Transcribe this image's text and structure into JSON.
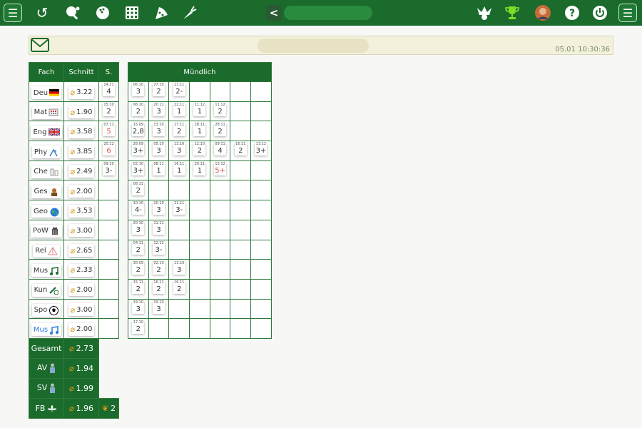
{
  "topbar": {
    "left_icons": [
      "menu-icon",
      "history-icon",
      "table-tennis-icon",
      "bowling-icon",
      "calculator-icon",
      "pizza-icon",
      "carrot-icon"
    ],
    "right_icons": [
      "jester-icon",
      "trophy-icon",
      "avatar",
      "help-icon",
      "power-icon",
      "menu-icon"
    ],
    "back_label": "<"
  },
  "message_bar": {
    "timestamp": "05.01 10:30:36"
  },
  "left_table": {
    "headers": {
      "subject": "Fach",
      "average": "Schnitt",
      "written": "S."
    },
    "rows": [
      {
        "subject": "Deu",
        "avg": "3.22",
        "written": {
          "date": "14.11",
          "grade": "4",
          "red": false
        }
      },
      {
        "subject": "Mat",
        "avg": "1.90",
        "written": {
          "date": "15.10",
          "grade": "2",
          "red": false
        }
      },
      {
        "subject": "Eng",
        "avg": "3.58",
        "written": {
          "date": "07.11",
          "grade": "5",
          "red": true
        }
      },
      {
        "subject": "Phy",
        "avg": "3.85",
        "written": {
          "date": "20.12",
          "grade": "6",
          "red": true
        }
      },
      {
        "subject": "Che",
        "avg": "2.49",
        "written": {
          "date": "09.10",
          "grade": "3-",
          "red": false
        }
      },
      {
        "subject": "Ges",
        "avg": "2.00",
        "written": null
      },
      {
        "subject": "Geo",
        "avg": "3.53",
        "written": null
      },
      {
        "subject": "PoW",
        "avg": "3.00",
        "written": null
      },
      {
        "subject": "Rel",
        "avg": "2.65",
        "written": null
      },
      {
        "subject": "Mus",
        "avg": "2.33",
        "written": null
      },
      {
        "subject": "Kun",
        "avg": "2.00",
        "written": null
      },
      {
        "subject": "Spo",
        "avg": "3.00",
        "written": null
      },
      {
        "subject": "Mus",
        "avg": "2.00",
        "written": null,
        "blue": true
      }
    ],
    "summary": [
      {
        "label": "Gesamt",
        "avg": "2.73"
      },
      {
        "label": "AV",
        "avg": "1.94"
      },
      {
        "label": "SV",
        "avg": "1.99"
      },
      {
        "label": "FB",
        "avg": "1.96",
        "extra": "2"
      }
    ]
  },
  "right_table": {
    "header": "Mündlich",
    "rows": [
      [
        [
          "06.10",
          "3"
        ],
        [
          "27.10",
          "2"
        ],
        [
          "11.11",
          "2-"
        ]
      ],
      [
        [
          "06.10",
          "2"
        ],
        [
          "20.11",
          "3"
        ],
        [
          "22.11",
          "1"
        ],
        [
          "11.12",
          "1"
        ],
        [
          "11.12",
          "2"
        ]
      ],
      [
        [
          "15.09",
          "2,8"
        ],
        [
          "13.10",
          "3"
        ],
        [
          "17.11",
          "2"
        ],
        [
          "28.11",
          "1"
        ],
        [
          "28.11",
          "2"
        ]
      ],
      [
        [
          "28.09",
          "3+"
        ],
        [
          "05.10",
          "3"
        ],
        [
          "12.10",
          "3"
        ],
        [
          "12.10",
          "2"
        ],
        [
          "09.11",
          "4"
        ],
        [
          "16.11",
          "2"
        ],
        [
          "13.12",
          "3+"
        ]
      ],
      [
        [
          "02.10",
          "3+"
        ],
        [
          "08.11",
          "1"
        ],
        [
          "16.11",
          "1"
        ],
        [
          "20.11",
          "1"
        ],
        [
          "13.12",
          "5+",
          "red"
        ]
      ],
      [
        [
          "08.11",
          "2"
        ]
      ],
      [
        [
          "10.10",
          "4-"
        ],
        [
          "10.10",
          "3"
        ],
        [
          "21.11",
          "3-"
        ]
      ],
      [
        [
          "20.10",
          "3"
        ],
        [
          "11.11",
          "3"
        ]
      ],
      [
        [
          "04.11",
          "2"
        ],
        [
          "12.12",
          "3-"
        ]
      ],
      [
        [
          "30.09",
          "2"
        ],
        [
          "02.10",
          "2"
        ],
        [
          "13.10",
          "3"
        ]
      ],
      [
        [
          "15.11",
          "2"
        ],
        [
          "16.11",
          "2"
        ],
        [
          "16.11",
          "2"
        ]
      ],
      [
        [
          "19.10",
          "3"
        ],
        [
          "19.10",
          "3"
        ]
      ],
      [
        [
          "17.10",
          "2"
        ]
      ]
    ]
  }
}
